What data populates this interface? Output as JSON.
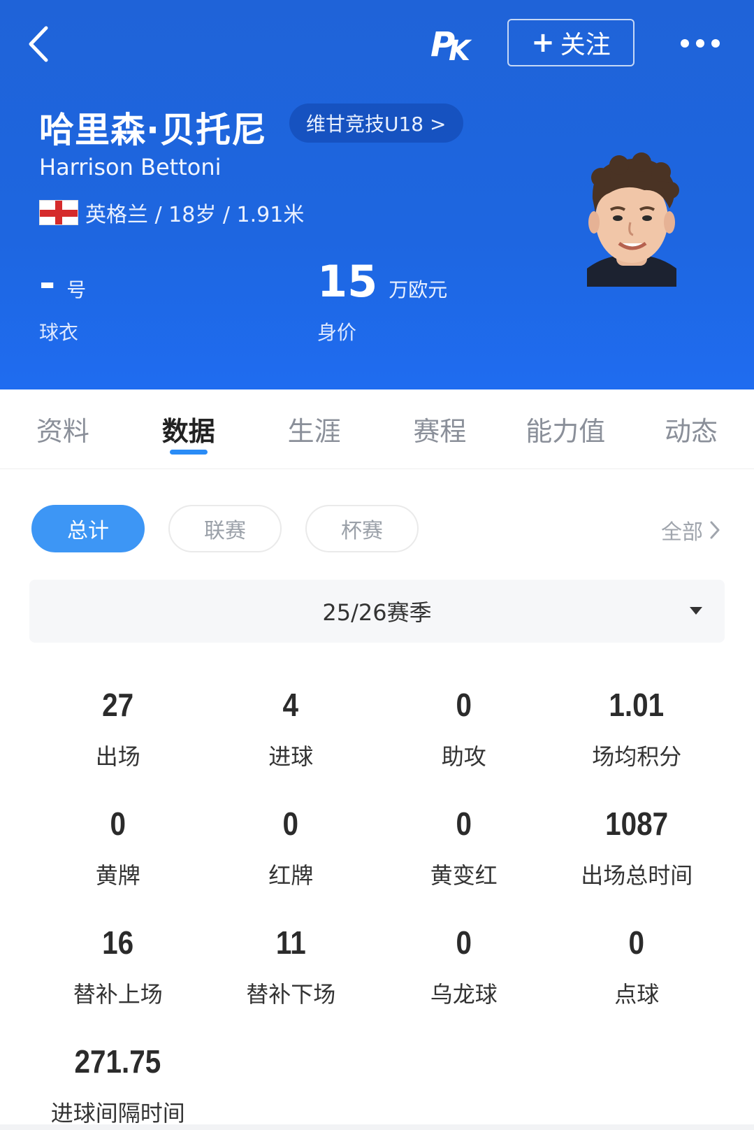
{
  "header": {
    "follow_label": "关注",
    "logo_text": "PK",
    "player": {
      "name_cn": "哈里森·贝托尼",
      "name_en": "Harrison Bettoni",
      "team": "维甘竞技U18 >",
      "nation_line": "英格兰 / 18岁 / 1.91米",
      "jersey_number": "-",
      "jersey_unit": "号",
      "jersey_label": "球衣",
      "market_value": "15",
      "market_value_unit": "万欧元",
      "market_value_label": "身价"
    }
  },
  "tabs": [
    "资料",
    "数据",
    "生涯",
    "赛程",
    "能力值",
    "动态"
  ],
  "active_tab": "数据",
  "filters": {
    "chips": [
      "总计",
      "联赛",
      "杯赛"
    ],
    "active": "总计",
    "all_label": "全部"
  },
  "season": "25/26赛季",
  "stats": [
    {
      "value": "27",
      "label": "出场"
    },
    {
      "value": "4",
      "label": "进球"
    },
    {
      "value": "0",
      "label": "助攻"
    },
    {
      "value": "1.01",
      "label": "场均积分"
    },
    {
      "value": "0",
      "label": "黄牌"
    },
    {
      "value": "0",
      "label": "红牌"
    },
    {
      "value": "0",
      "label": "黄变红"
    },
    {
      "value": "1087",
      "label": "出场总时间"
    },
    {
      "value": "16",
      "label": "替补上场"
    },
    {
      "value": "11",
      "label": "替补下场"
    },
    {
      "value": "0",
      "label": "乌龙球"
    },
    {
      "value": "0",
      "label": "点球"
    },
    {
      "value": "271.75",
      "label": "进球间隔时间"
    }
  ],
  "colors": {
    "header_blue": "#1f66e0",
    "accent_blue": "#3d96f5",
    "flag_red": "#d52b2b"
  }
}
